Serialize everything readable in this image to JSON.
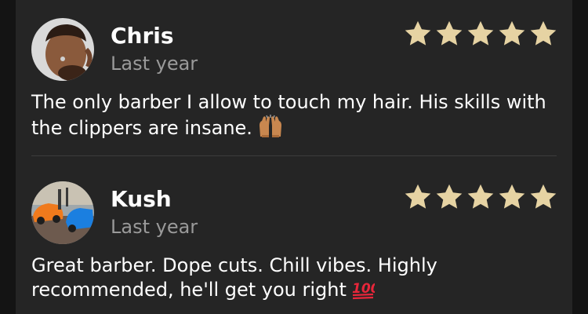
{
  "reviews": [
    {
      "name": "Chris",
      "date": "Last year",
      "rating": 5,
      "text": "The only barber I allow to touch my hair. His skills with the clippers are insane.",
      "emoji": "raising-hands-emoji",
      "avatar": "avatar-chris"
    },
    {
      "name": "Kush",
      "date": "Last year",
      "rating": 5,
      "text": "Great barber. Dope cuts. Chill vibes. Highly recommended, he'll get you right",
      "emoji": "hundred-points-emoji",
      "avatar": "avatar-kush"
    }
  ],
  "colors": {
    "background": "#252525",
    "outer": "#141414",
    "star": "#e6d3a3",
    "name": "#ffffff",
    "date": "#9a9a9a",
    "divider": "#3c3c3c"
  }
}
